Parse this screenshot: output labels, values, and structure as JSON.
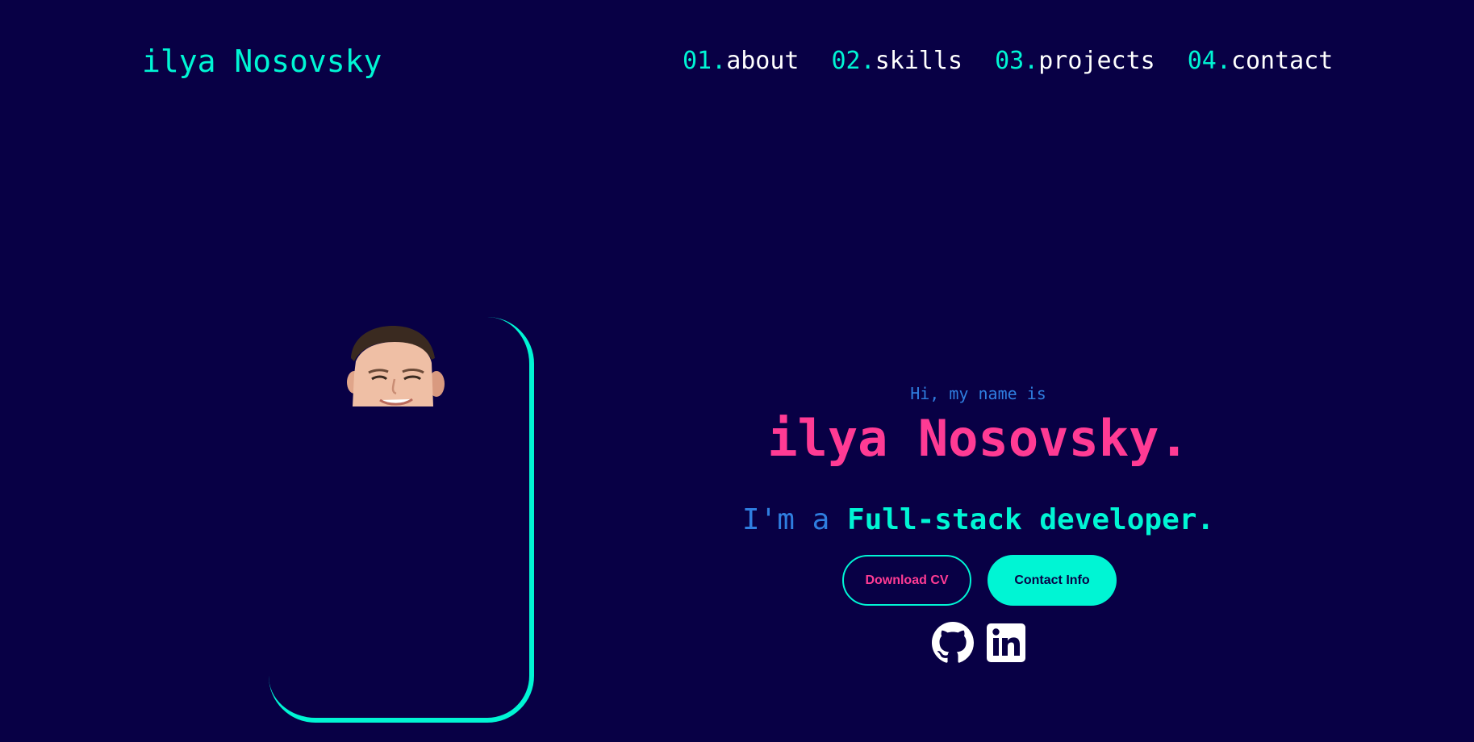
{
  "header": {
    "logo": "ilya Nosovsky",
    "nav": [
      {
        "number": "01.",
        "label": "about"
      },
      {
        "number": "02.",
        "label": "skills"
      },
      {
        "number": "03.",
        "label": "projects"
      },
      {
        "number": "04.",
        "label": "contact"
      }
    ]
  },
  "hero": {
    "greeting": "Hi, my name is",
    "name": "ilya Nosovsky.",
    "tagline_prefix": "I'm a ",
    "tagline_role": "Full-stack developer.",
    "buttons": {
      "download_cv": "Download CV",
      "contact_info": "Contact Info"
    },
    "social": [
      "github-icon",
      "linkedin-icon"
    ]
  },
  "colors": {
    "background": "#080045",
    "accent_cyan": "#00f5d4",
    "accent_pink": "#ff3b94",
    "accent_blue": "#2f7ee0",
    "text_white": "#ffffff"
  }
}
